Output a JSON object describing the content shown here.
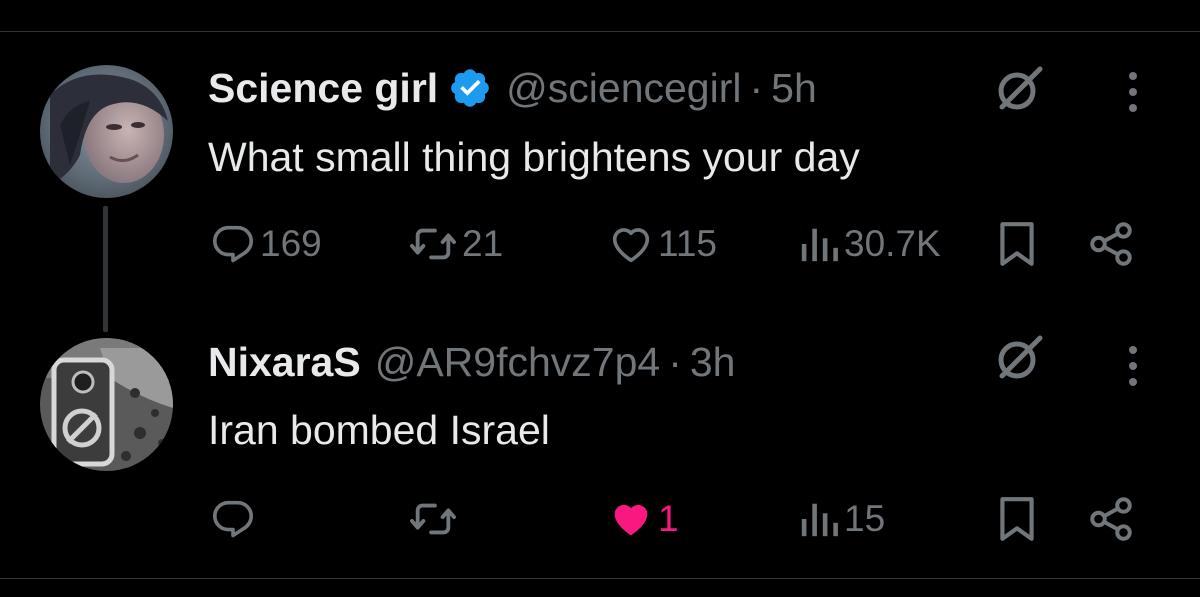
{
  "colors": {
    "background": "#000000",
    "primary_text": "#e7e9ea",
    "secondary_text": "#71767b",
    "divider": "#2f3336",
    "verified_blue": "#1d9bf0",
    "like_pink": "#f91880"
  },
  "tweets": [
    {
      "display_name": "Science girl",
      "verified": true,
      "handle": "@sciencegirl",
      "separator": "·",
      "time": "5h",
      "text": "What small thing brightens your day",
      "actions": {
        "reply_count": "169",
        "retweet_count": "21",
        "like_count": "115",
        "liked": false,
        "views_count": "30.7K"
      },
      "icons": [
        "reply-icon",
        "retweet-icon",
        "heart-icon",
        "views-icon",
        "bookmark-icon",
        "share-icon",
        "grok-icon",
        "more-icon"
      ]
    },
    {
      "display_name": "NixaraS",
      "verified": false,
      "handle": "@AR9fchvz7p4",
      "separator": "·",
      "time": "3h",
      "text": "Iran bombed Israel",
      "actions": {
        "reply_count": "",
        "retweet_count": "",
        "like_count": "1",
        "liked": true,
        "views_count": "15"
      },
      "icons": [
        "reply-icon",
        "retweet-icon",
        "heart-filled-icon",
        "views-icon",
        "bookmark-icon",
        "share-icon",
        "grok-icon",
        "more-icon"
      ]
    }
  ]
}
